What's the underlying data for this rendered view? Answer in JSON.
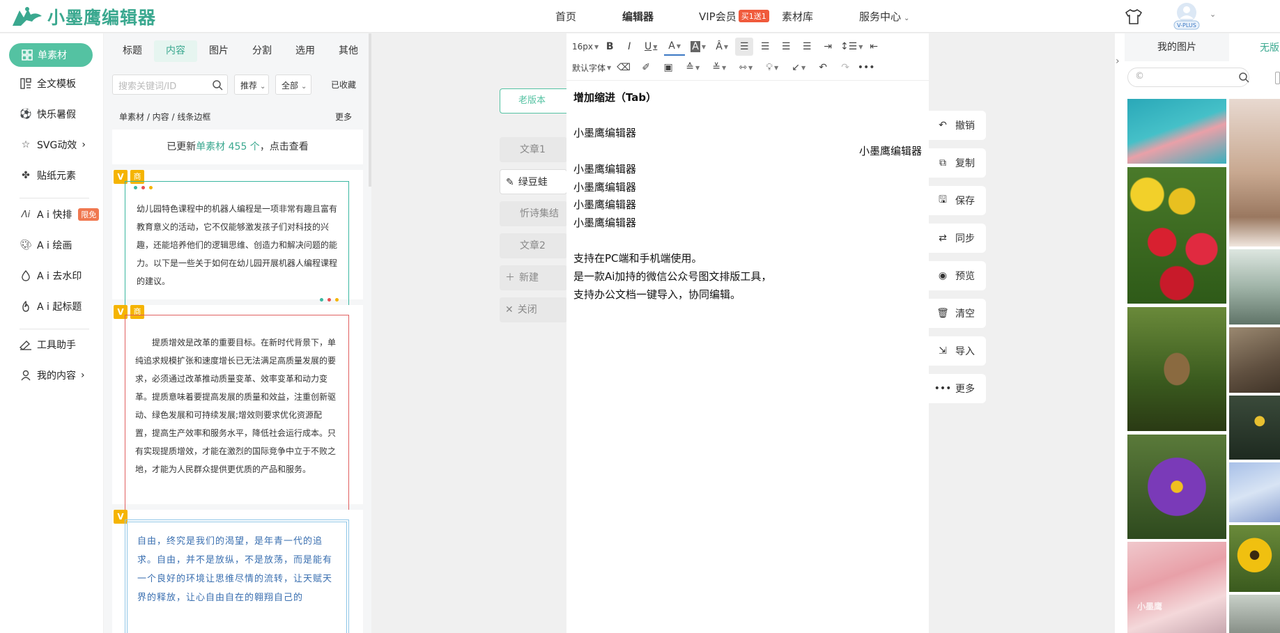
{
  "header": {
    "logo_text": "小墨鹰编辑器",
    "nav": [
      {
        "label": "首页"
      },
      {
        "label": "编辑器"
      },
      {
        "label": "VIP会员",
        "badge": "买1送1"
      },
      {
        "label": "素材库"
      },
      {
        "label": "服务中心"
      }
    ],
    "avatar_badge": "V-PLUS"
  },
  "rail": {
    "active": "单素材",
    "items": [
      {
        "label": "全文模板",
        "icon": "template-icon"
      },
      {
        "label": "快乐暑假",
        "icon": "ball-icon"
      },
      {
        "label": "SVG动效",
        "icon": "star-icon"
      },
      {
        "label": "贴纸元素",
        "icon": "sticker-icon"
      },
      {
        "label": "A i 快排",
        "icon": "ai-icon",
        "badge": "限免"
      },
      {
        "label": "A i 绘画",
        "icon": "palette-icon"
      },
      {
        "label": "A i 去水印",
        "icon": "drop-icon"
      },
      {
        "label": "A i 起标题",
        "icon": "flame-icon"
      },
      {
        "label": "工具助手",
        "icon": "tools-icon"
      },
      {
        "label": "我的内容",
        "icon": "user-icon"
      }
    ]
  },
  "panel": {
    "tabs": [
      "标题",
      "内容",
      "图片",
      "分割",
      "选用",
      "其他"
    ],
    "active_tab": "内容",
    "search_placeholder": "搜索关键词/ID",
    "sort": "推荐",
    "filter": "全部",
    "favorites": "已收藏",
    "breadcrumb": "单素材 / 内容 / 线条边框",
    "more": "更多",
    "update_prefix": "已更新",
    "update_highlight": "单素材 455 个",
    "update_suffix": "，点击查看",
    "tag_v": "V",
    "tag_shang": "商",
    "card1_text": "幼儿园特色课程中的机器人编程是一项非常有趣且富有教育意义的活动，它不仅能够激发孩子们对科技的兴趣，还能培养他们的逻辑思维、创造力和解决问题的能力。以下是一些关于如何在幼儿园开展机器人编程课程的建议。",
    "card2_text": "提质增效是改革的重要目标。在新时代背景下，单纯追求规模扩张和速度增长已无法满足高质量发展的要求，必须通过改革推动质量变革、效率变革和动力变革。提质意味着要提高发展的质量和效益，注重创新驱动、绿色发展和可持续发展;增效则要求优化资源配置，提高生产效率和服务水平，降低社会运行成本。只有实现提质增效，才能在激烈的国际竞争中立于不败之地，才能为人民群众提供更优质的产品和服务。",
    "card3_text": "自由，终究是我们的渴望，是年青一代的追求。自由，并不是放纵，不是放荡，而是能有一个良好的环境让思维尽情的流转，让天赋天界的释放，让心自由自在的翱翔自己的",
    "colors": {
      "accent": "#54c2a2",
      "dot1": "#3ab7a0",
      "dot2": "#e85050",
      "dot3": "#f5b400"
    }
  },
  "articles": {
    "old_version": "老版本",
    "items": [
      {
        "label": "文章1"
      },
      {
        "label": "绿豆蛙",
        "active": true
      },
      {
        "label": "忻诗集结"
      },
      {
        "label": "文章2"
      }
    ],
    "new": "新建",
    "close": "关闭"
  },
  "toolbar": {
    "font_size": "16px",
    "font_family": "默认字体"
  },
  "editor": {
    "lines": [
      {
        "text": "增加缩进（Tab）",
        "bold": true
      },
      {
        "text": ""
      },
      {
        "text": "小墨鹰编辑器"
      },
      {
        "text": "小墨鹰编辑器",
        "align": "right"
      },
      {
        "text": "小墨鹰编辑器"
      },
      {
        "text": "小墨鹰编辑器"
      },
      {
        "text": "小墨鹰编辑器"
      },
      {
        "text": "小墨鹰编辑器"
      },
      {
        "text": ""
      },
      {
        "text": "支持在PC端和手机端使用。"
      },
      {
        "text": "是一款Ai加持的微信公众号图文排版工具，"
      },
      {
        "text": "支持办公文档一键导入，协同编辑。"
      }
    ]
  },
  "actions": [
    {
      "label": "撤销",
      "icon": "undo-icon"
    },
    {
      "label": "复制",
      "icon": "copy-icon"
    },
    {
      "label": "保存",
      "icon": "save-icon"
    },
    {
      "label": "同步",
      "icon": "sync-icon"
    },
    {
      "label": "预览",
      "icon": "eye-icon"
    },
    {
      "label": "清空",
      "icon": "trash-icon"
    },
    {
      "label": "导入",
      "icon": "import-icon"
    },
    {
      "label": "更多",
      "icon": "more-icon"
    }
  ],
  "images": {
    "tab_mine": "我的图片",
    "tab_free": "无版",
    "search_prefix": "©",
    "watermark": "小墨鹰"
  }
}
